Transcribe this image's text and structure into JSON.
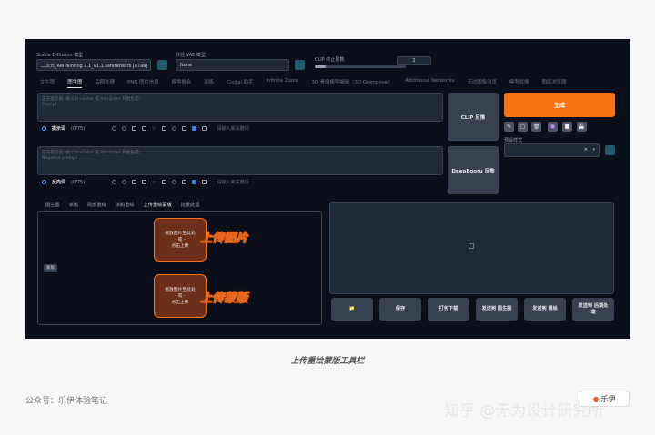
{
  "top": {
    "model_label": "Stable Diffusion 模型",
    "model_value": "二次元_AWPainting 1.1_v1.1.safetensors [e7aa]",
    "vae_label": "外挂 VAE 模型",
    "vae_value": "None",
    "clip_label": "CLIP 终止层数",
    "clip_value": "2"
  },
  "tabs": [
    "文生图",
    "图生图",
    "后期处理",
    "PNG 图片信息",
    "模型融合",
    "训练",
    "Civitai 助手",
    "Infinite Zoom",
    "3D 骨骼模型编辑（3D Openpose）",
    "Additional Networks",
    "无边图像浏览",
    "模型转换",
    "图库浏览器"
  ],
  "prompt": {
    "placeholder_line1": "正向提示词 (按 Ctrl+Enter 或 Alt+Enter 开始生成)",
    "placeholder_line2": "Prompt",
    "label": "提示词",
    "count": "(0/75)",
    "keyword_placeholder": "请输入新关键词"
  },
  "negative": {
    "placeholder_line1": "反向提示词 (按 Ctrl+Enter 或 Alt+Enter 开始生成)",
    "placeholder_line2": "Negative prompt",
    "label": "反向词",
    "count": "(0/75)",
    "keyword_placeholder": "请输入新关键词"
  },
  "buttons": {
    "clip": "CLIP 反推",
    "deepbooru": "DeepBooru 反推",
    "generate": "生成",
    "preset_label": "预设样式",
    "preset_clear": "×"
  },
  "tool_icons": [
    "✎",
    "◻",
    "🗑",
    "●",
    "📋",
    "💾"
  ],
  "subtabs": [
    "图生图",
    "涂鸦",
    "局部重绘",
    "涂鸦重绘",
    "上传重绘蒙版",
    "批量处理"
  ],
  "active_subtab": 4,
  "upload_badge": "蒙版",
  "drop1": {
    "line1": "拖放图片至此处",
    "line2": "- 或 -",
    "line3": "点击上传"
  },
  "drop2": {
    "line1": "拖放图片至此处",
    "line2": "- 或 -",
    "line3": "点击上传"
  },
  "callout1": "上传图片",
  "callout2": "上传蒙版",
  "output_actions": [
    {
      "label": "📁"
    },
    {
      "label": "保存"
    },
    {
      "label": "打包下载"
    },
    {
      "label": "发送到 图生图"
    },
    {
      "label": "发送到 重绘"
    },
    {
      "label": "发送到 后期处理"
    }
  ],
  "caption": "上传重绘蒙版工具栏",
  "footer": "公众号：乐伊体验笔记",
  "watermark": "知乎 @无为设计研究所",
  "logo_text": "乐伊",
  "accent": "#f97316"
}
